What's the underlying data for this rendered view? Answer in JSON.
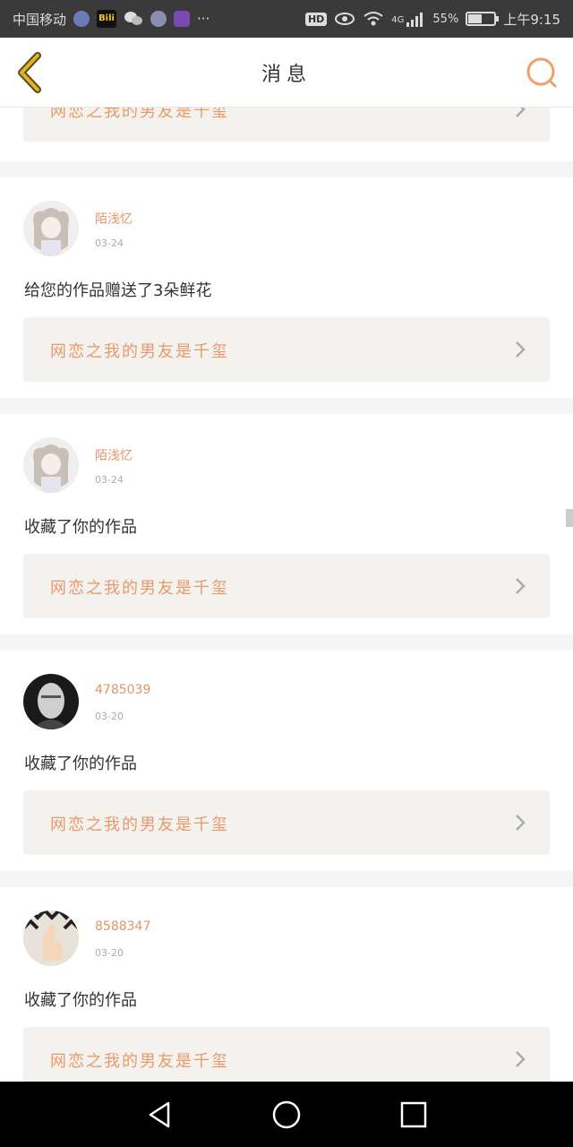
{
  "status_bar": {
    "carrier": "中国移动",
    "bili_label": "Bili",
    "more": "···",
    "hd": "HD",
    "network": "4G",
    "battery_text": "55%",
    "battery_level": 0.55,
    "time": "上午9:15"
  },
  "header": {
    "title": "消息"
  },
  "top_card": {
    "work_title": "网恋之我的男友是千玺"
  },
  "messages": [
    {
      "username": "陌浅忆",
      "date": "03-24",
      "action": "给您的作品赠送了3朵鲜花",
      "work_title": "网恋之我的男友是千玺",
      "avatar": "anime-girl-avatar"
    },
    {
      "username": "陌浅忆",
      "date": "03-24",
      "action": "收藏了你的作品",
      "work_title": "网恋之我的男友是千玺",
      "avatar": "anime-girl-avatar"
    },
    {
      "username": "4785039",
      "date": "03-20",
      "action": "收藏了你的作品",
      "work_title": "网恋之我的男友是千玺",
      "avatar": "man-portrait-avatar"
    },
    {
      "username": "8588347",
      "date": "03-20",
      "action": "收藏了你的作品",
      "work_title": "网恋之我的男友是千玺",
      "avatar": "thumbs-up-avatar"
    }
  ],
  "colors": {
    "accent": "#e89a6c",
    "back_icon": "#e0b12a",
    "card_bg": "#f3f2ee",
    "status_bar_bg": "#3a3a3a"
  }
}
